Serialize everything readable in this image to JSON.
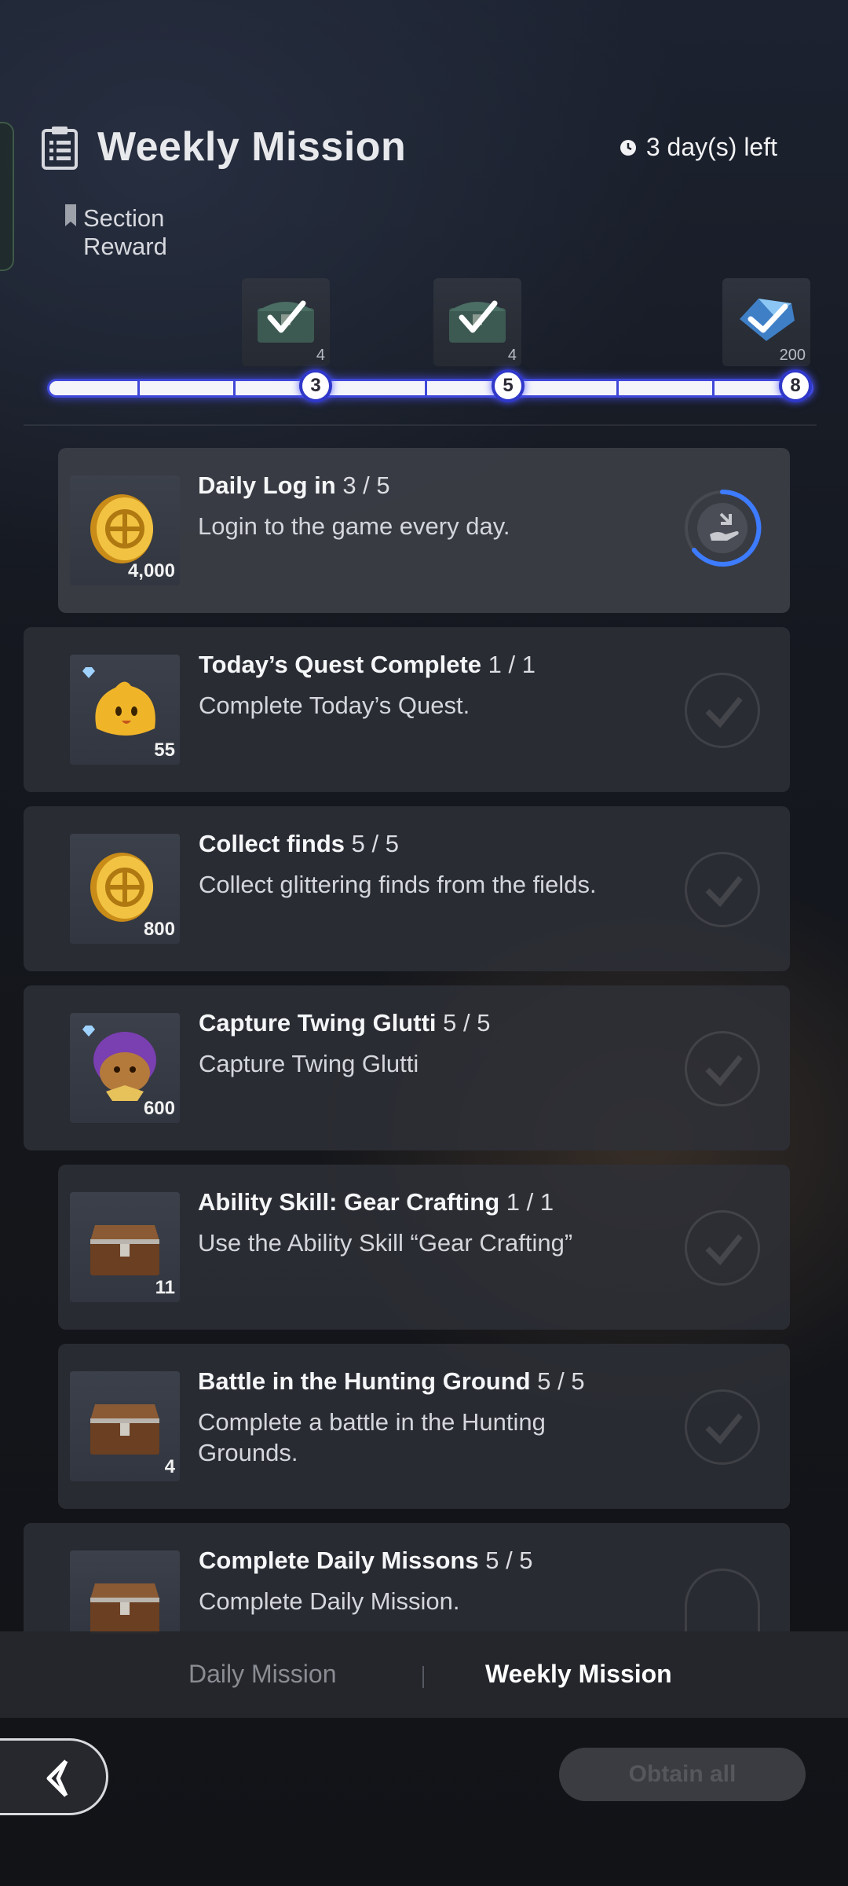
{
  "header": {
    "title": "Weekly Mission",
    "time_left": "3 day(s) left",
    "clipboard_icon": "clipboard-icon",
    "clock_icon": "clock-icon"
  },
  "section_reward": {
    "label": "Section\nReward",
    "icon": "bookmark-icon"
  },
  "milestones": [
    {
      "node": "3",
      "reward_icon": "treasure-chest-icon",
      "reward_count": "4",
      "claimed": true
    },
    {
      "node": "5",
      "reward_icon": "treasure-chest-icon",
      "reward_count": "4",
      "claimed": true
    },
    {
      "node": "8",
      "reward_icon": "diamond-gem-icon",
      "reward_count": "200",
      "claimed": true
    }
  ],
  "progress": {
    "current": 8,
    "max": 8
  },
  "missions": [
    {
      "title": "Daily Log in",
      "progress": "3 / 5",
      "desc": "Login to the game every day.",
      "reward_icon": "gold-coin-icon",
      "reward_count": "4,000",
      "status": "claimable"
    },
    {
      "title": "Today’s Quest Complete",
      "progress": "1 / 1",
      "desc": "Complete Today’s Quest.",
      "reward_icon": "yellow-slime-icon",
      "reward_count": "55",
      "status": "completed"
    },
    {
      "title": "Collect finds",
      "progress": "5 / 5",
      "desc": "Collect glittering finds from the fields.",
      "reward_icon": "gold-coin-icon",
      "reward_count": "800",
      "status": "completed"
    },
    {
      "title": "Capture Twing Glutti",
      "progress": "5 / 5",
      "desc": "Capture Twing Glutti",
      "reward_icon": "twing-glutti-icon",
      "reward_count": "600",
      "status": "completed"
    },
    {
      "title": "Ability Skill: Gear Crafting",
      "progress": "1 / 1",
      "desc": "Use the Ability Skill “Gear Crafting”",
      "reward_icon": "treasure-chest-icon",
      "reward_count": "11",
      "status": "completed"
    },
    {
      "title": "Battle in the Hunting Ground",
      "progress": "5 / 5",
      "desc": "Complete a battle in the Hunting Grounds.",
      "reward_icon": "treasure-chest-icon",
      "reward_count": "4",
      "status": "completed"
    },
    {
      "title": "Complete Daily Missons",
      "progress": "5 / 5",
      "desc": "Complete Daily Mission.",
      "reward_icon": "treasure-chest-icon",
      "reward_count": "",
      "status": "completed"
    }
  ],
  "tabs": {
    "daily": "Daily Mission",
    "weekly": "Weekly Mission",
    "active": "weekly"
  },
  "footer": {
    "back_icon": "back-arrow-icon",
    "obtain_all": "Obtain all",
    "obtain_all_enabled": false
  },
  "colors": {
    "track_border": "#3f48d8",
    "track_fill": "#f4f5fb",
    "claim_ring": "#3d7bff"
  }
}
